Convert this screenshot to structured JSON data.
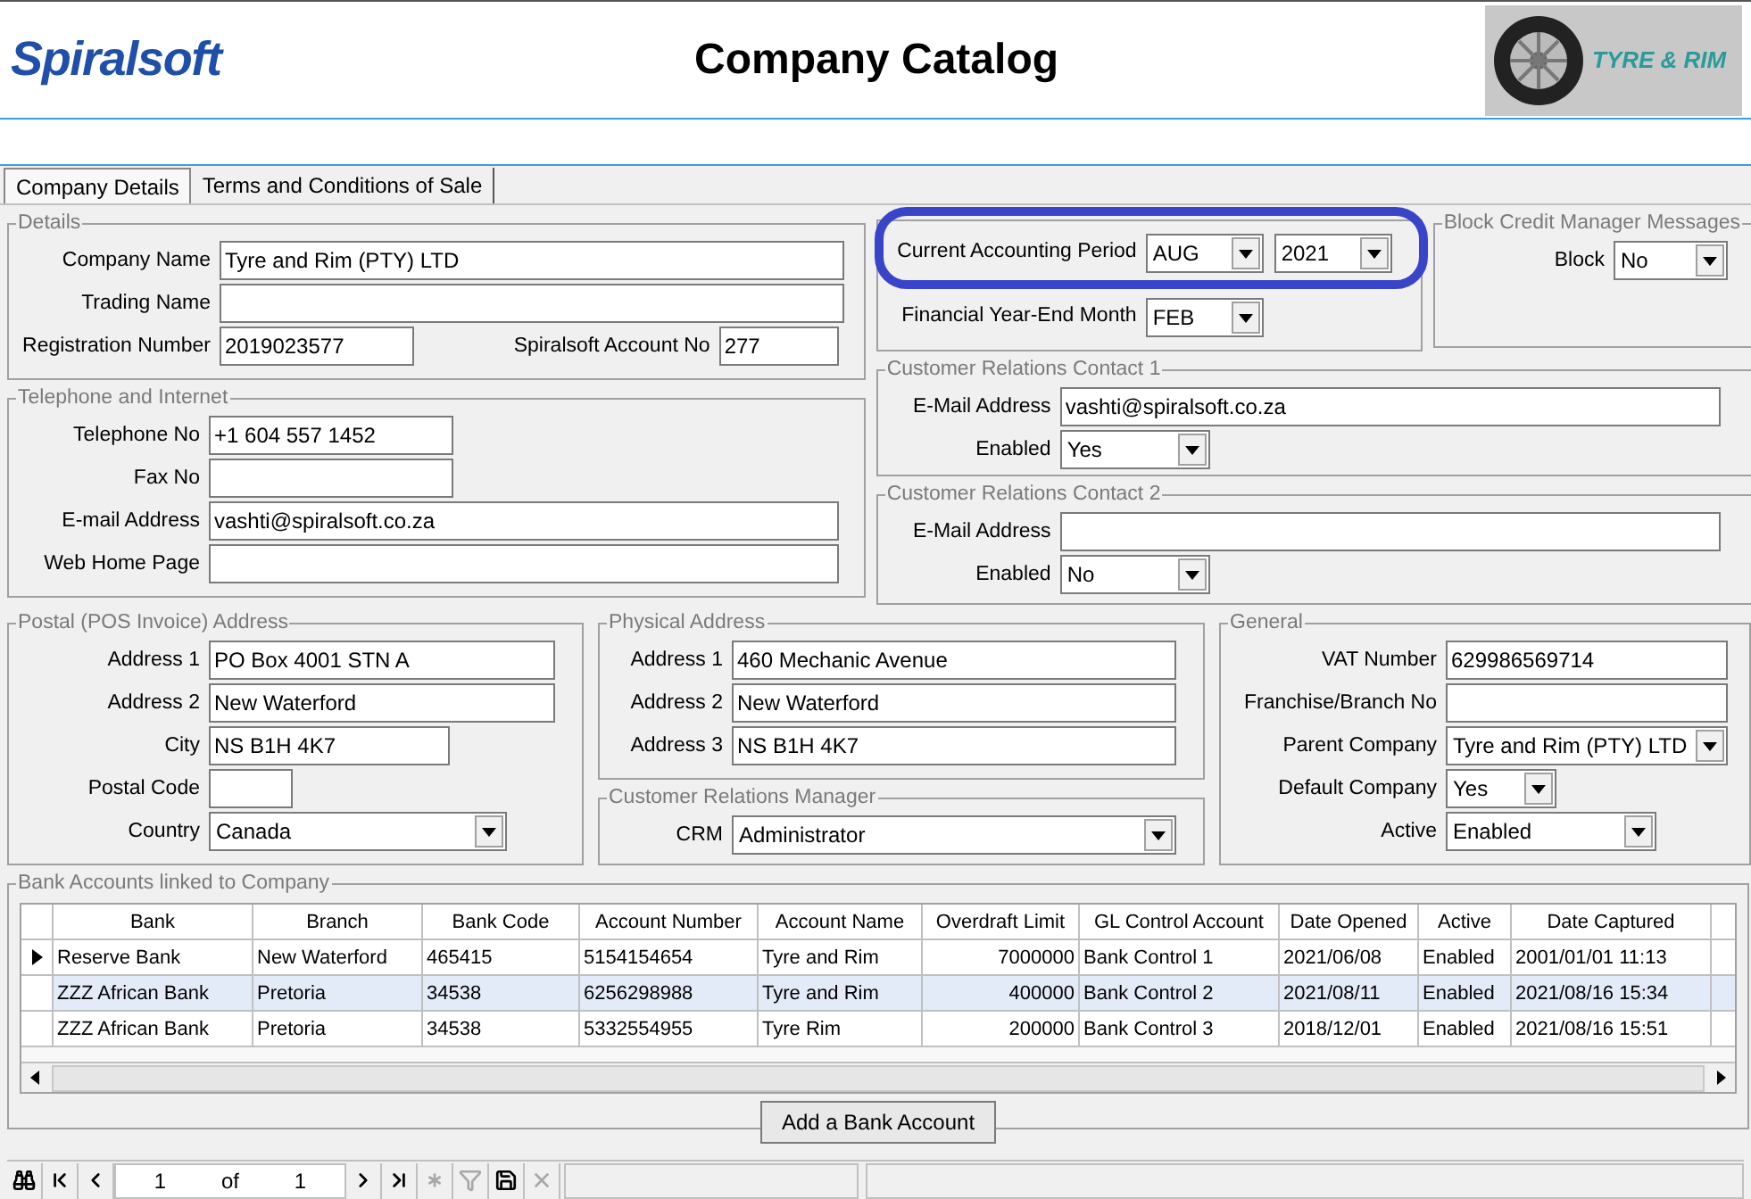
{
  "header": {
    "logo": "Spiralsoft",
    "title": "Company Catalog",
    "brand_logo": "TYRE & RIM"
  },
  "tabs": [
    {
      "label": "Company Details",
      "selected": true
    },
    {
      "label": "Terms and Conditions of Sale",
      "selected": false
    }
  ],
  "details": {
    "title": "Details",
    "company_name": {
      "label": "Company Name",
      "value": "Tyre and Rim (PTY) LTD"
    },
    "trading_name": {
      "label": "Trading Name"
    },
    "registration": {
      "label": "Registration Number",
      "value": "2019023577"
    },
    "account_no": {
      "label": "Spiralsoft Account No",
      "value": "277"
    }
  },
  "telephone": {
    "title": "Telephone and Internet",
    "telephone": {
      "label": "Telephone No",
      "value": "+1 604 557 1452"
    },
    "fax": {
      "label": "Fax No"
    },
    "email": {
      "label": "E-mail Address",
      "value": "vashti@spiralsoft.co.za"
    },
    "web": {
      "label": "Web Home Page"
    }
  },
  "accounting": {
    "current_period": {
      "label": "Current Accounting Period",
      "month": "AUG",
      "year": "2021"
    },
    "year_end": {
      "label": "Financial Year-End Month",
      "value": "FEB"
    }
  },
  "block_credit": {
    "title": "Block Credit Manager Messages",
    "block": {
      "label": "Block",
      "value": "No"
    }
  },
  "contact_1": {
    "title": "Customer Relations Contact 1",
    "email": {
      "label": "E-Mail Address",
      "value": "vashti@spiralsoft.co.za"
    },
    "enabled": {
      "label": "Enabled",
      "value": "Yes"
    }
  },
  "contact_2": {
    "title": "Customer Relations Contact 2",
    "email": {
      "label": "E-Mail Address"
    },
    "enabled": {
      "label": "Enabled",
      "value": "No"
    }
  },
  "postal": {
    "title": "Postal (POS Invoice) Address",
    "address_1": {
      "label": "Address 1",
      "value": "PO Box 4001 STN A"
    },
    "address_2": {
      "label": "Address 2",
      "value": "New Waterford"
    },
    "city": {
      "label": "City",
      "value": "NS B1H 4K7"
    },
    "postal_code": {
      "label": "Postal Code"
    },
    "country": {
      "label": "Country",
      "value": "Canada"
    }
  },
  "physical": {
    "title": "Physical Address",
    "address_1": {
      "label": "Address 1",
      "value": "460 Mechanic Avenue"
    },
    "address_2": {
      "label": "Address 2",
      "value": "New Waterford"
    },
    "address_3": {
      "label": "Address 3",
      "value": "NS B1H 4K7"
    }
  },
  "crm": {
    "title": "Customer Relations Manager",
    "crm": {
      "label": "CRM",
      "value": "Administrator"
    }
  },
  "general": {
    "title": "General",
    "vat": {
      "label": "VAT Number",
      "value": "629986569714"
    },
    "franchise": {
      "label": "Franchise/Branch No"
    },
    "parent": {
      "label": "Parent Company",
      "value": "Tyre and Rim (PTY) LTD"
    },
    "default": {
      "label": "Default Company",
      "value": "Yes"
    },
    "active": {
      "label": "Active",
      "value": "Enabled"
    }
  },
  "bank": {
    "title": "Bank Accounts linked to Company",
    "table": {
      "columns": [
        "Bank",
        "Branch",
        "Bank Code",
        "Account Number",
        "Account Name",
        "Overdraft Limit",
        "GL Control Account",
        "Date Opened",
        "Active",
        "Date Captured"
      ],
      "rows": [
        {
          "current": true,
          "selected": false,
          "cells": [
            "Reserve Bank",
            "New Waterford",
            "465415",
            "5154154654",
            "Tyre and Rim",
            "7000000",
            "Bank Control 1",
            "2021/06/08",
            "Enabled",
            "2001/01/01 11:13"
          ]
        },
        {
          "current": false,
          "selected": true,
          "cells": [
            "ZZZ African Bank",
            "Pretoria",
            "34538",
            "6256298988",
            "Tyre and Rim",
            "400000",
            "Bank Control 2",
            "2021/08/11",
            "Enabled",
            "2021/08/16 15:34"
          ]
        },
        {
          "current": false,
          "selected": false,
          "cells": [
            "ZZZ African Bank",
            "Pretoria",
            "34538",
            "5332554955",
            "Tyre Rim",
            "200000",
            "Bank Control 3",
            "2018/12/01",
            "Enabled",
            "2021/08/16 15:51"
          ]
        }
      ]
    },
    "add_button": "Add a Bank Account"
  },
  "nav": {
    "left_buttons": [
      {
        "kind": "find",
        "disabled": false
      },
      {
        "kind": "first",
        "disabled": false
      },
      {
        "kind": "prev",
        "disabled": false
      }
    ],
    "page": "1",
    "of": "of",
    "total": "1",
    "right_buttons": [
      {
        "kind": "next",
        "disabled": false
      },
      {
        "kind": "last",
        "disabled": false
      },
      {
        "kind": "new",
        "disabled": true
      },
      {
        "kind": "filter",
        "disabled": true
      },
      {
        "kind": "save",
        "disabled": false
      },
      {
        "kind": "delete",
        "disabled": true
      }
    ]
  }
}
